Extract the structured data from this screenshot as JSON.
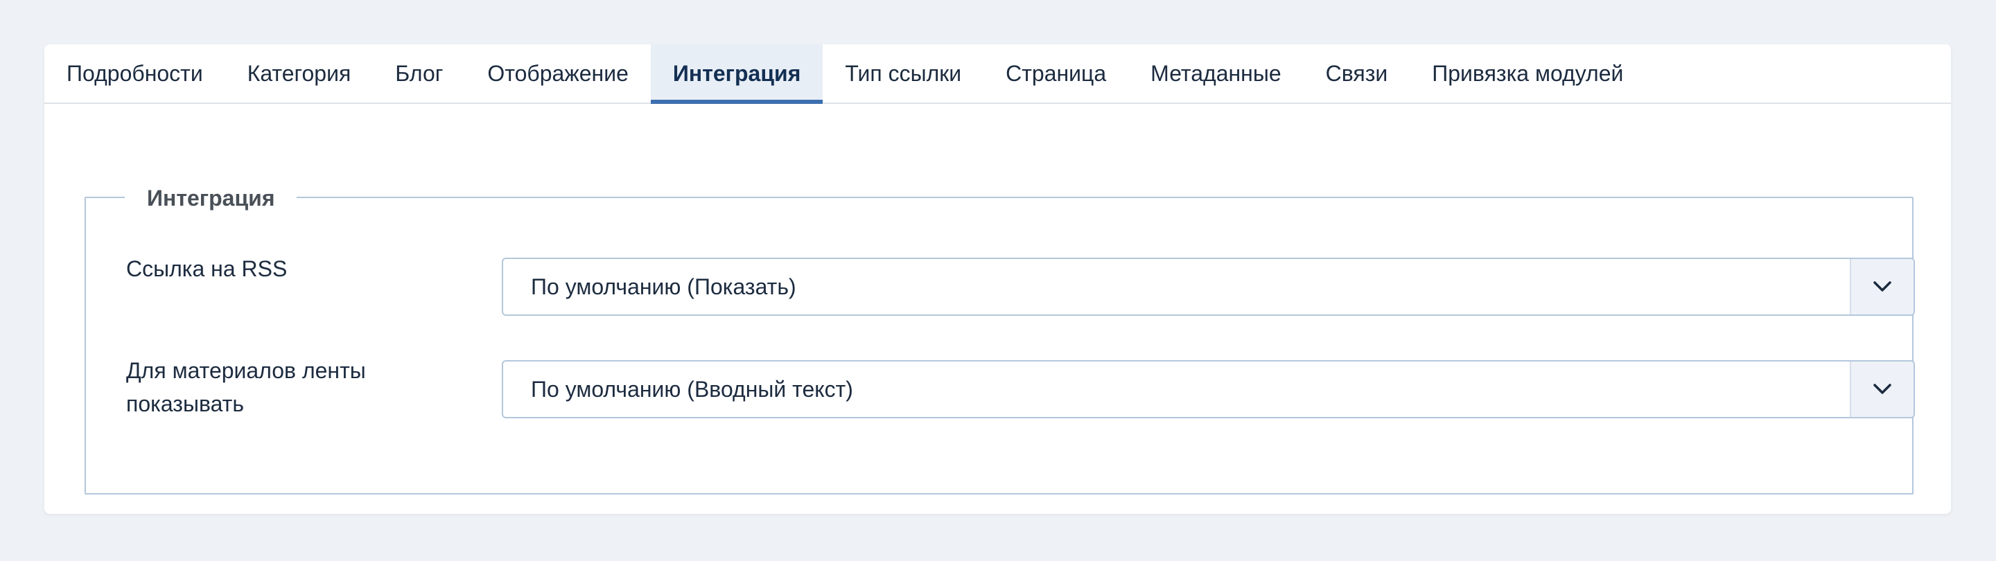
{
  "tabs": [
    {
      "label": "Подробности",
      "active": false
    },
    {
      "label": "Категория",
      "active": false
    },
    {
      "label": "Блог",
      "active": false
    },
    {
      "label": "Отображение",
      "active": false
    },
    {
      "label": "Интеграция",
      "active": true
    },
    {
      "label": "Тип ссылки",
      "active": false
    },
    {
      "label": "Страница",
      "active": false
    },
    {
      "label": "Метаданные",
      "active": false
    },
    {
      "label": "Связи",
      "active": false
    },
    {
      "label": "Привязка модулей",
      "active": false
    }
  ],
  "fieldset": {
    "legend": "Интеграция",
    "fields": [
      {
        "label": "Ссылка на RSS",
        "value": "По умолчанию (Показать)",
        "icon": "chevron-down-icon"
      },
      {
        "label_line1": "Для материалов ленты",
        "label_line2": "показывать",
        "value": "По умолчанию (Вводный текст)",
        "icon": "chevron-down-icon"
      }
    ]
  },
  "colors": {
    "page_bg": "#eef2f6",
    "accent": "#3d6fb0",
    "active_tab_bg": "#e8eef5",
    "border": "#b3c7dc"
  }
}
